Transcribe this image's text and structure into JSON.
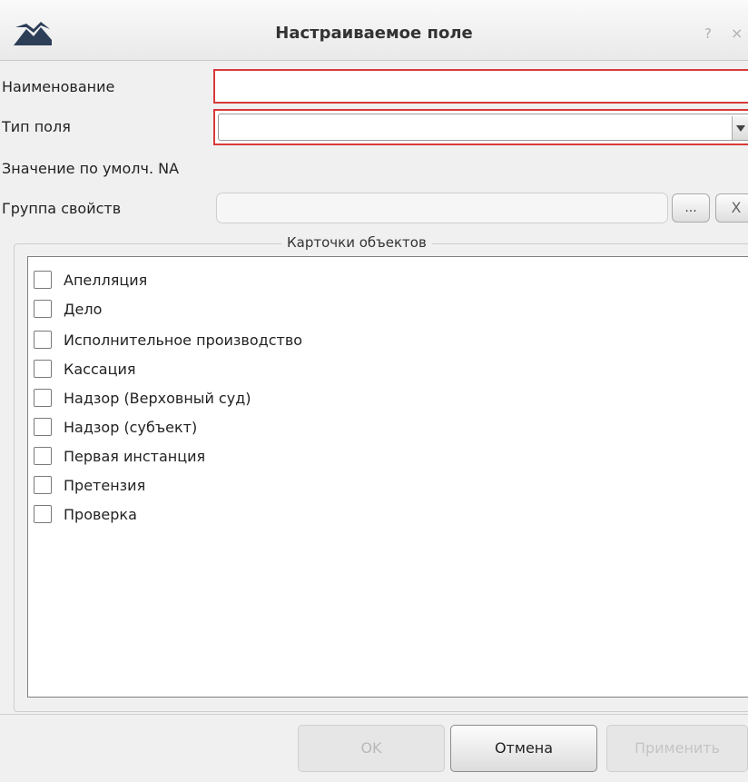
{
  "dialog": {
    "title": "Настраиваемое поле",
    "help_symbol": "?",
    "close_symbol": "×",
    "app_icon": "mountain-logo-icon"
  },
  "form": {
    "name_label": "Наименование",
    "name_value": "",
    "type_label": "Тип поля",
    "type_value": "",
    "default_label": "Значение по умолч.",
    "default_value": "NA",
    "group_label": "Группа свойств",
    "group_value": "",
    "browse_label": "...",
    "clear_label": "X",
    "invalid_border_color": "#d73a3a"
  },
  "cards": {
    "title": "Карточки объектов",
    "items": [
      {
        "label": "Апелляция",
        "checked": false
      },
      {
        "label": "Дело",
        "checked": false
      },
      {
        "label": "Исполнительное производство",
        "checked": false
      },
      {
        "label": "Кассация",
        "checked": false
      },
      {
        "label": "Надзор (Верховный суд)",
        "checked": false
      },
      {
        "label": "Надзор (субъект)",
        "checked": false
      },
      {
        "label": "Первая инстанция",
        "checked": false
      },
      {
        "label": "Претензия",
        "checked": false
      },
      {
        "label": "Проверка",
        "checked": false
      }
    ]
  },
  "buttons": {
    "ok": "OK",
    "cancel": "Отмена",
    "apply": "Применить"
  }
}
